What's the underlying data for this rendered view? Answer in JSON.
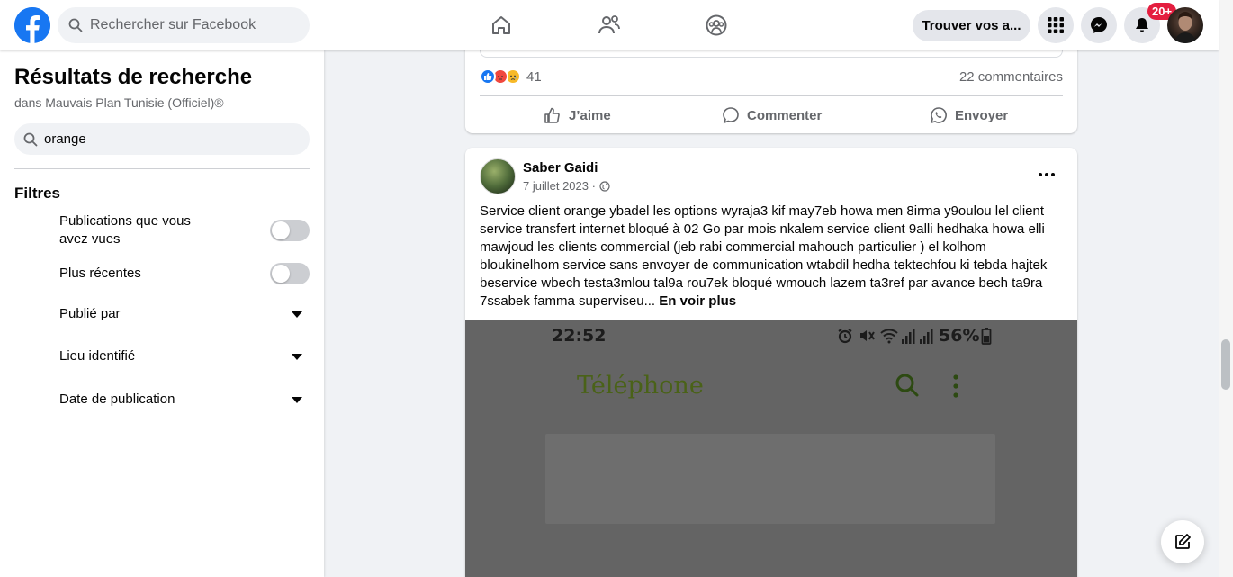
{
  "topbar": {
    "search_placeholder": "Rechercher sur Facebook",
    "find_friends_label": "Trouver vos a...",
    "notification_count": "20+"
  },
  "sidebar": {
    "title": "Résultats de recherche",
    "subtitle": "dans Mauvais Plan Tunisie (Officiel)®",
    "search_value": "orange",
    "filters_title": "Filtres",
    "filters": [
      {
        "label": "Publications que vous avez vues",
        "type": "toggle",
        "on": false
      },
      {
        "label": "Plus récentes",
        "type": "toggle",
        "on": false
      },
      {
        "label": "Publié par",
        "type": "dropdown"
      },
      {
        "label": "Lieu identifié",
        "type": "dropdown"
      },
      {
        "label": "Date de publication",
        "type": "dropdown"
      }
    ]
  },
  "post1": {
    "reaction_count": "41",
    "comments": "22 commentaires",
    "actions": {
      "like": "J’aime",
      "comment": "Commenter",
      "share": "Envoyer"
    }
  },
  "post2": {
    "author": "Saber Gaidi",
    "date": "7 juillet 2023 ·",
    "text": "Service client orange ybadel les options wyraja3 kif may7eb howa men 8irma y9oulou lel client service transfert internet bloqué à 02 Go par mois nkalem service client 9alli hedhaka howa elli mawjoud les clients commercial (jeb rabi commercial mahouch particulier ) el kolhom bloukinelhom service sans envoyer de communication wtabdil hedha tektechfou ki tebda hajtek beservice wbech testa3mlou tal9a rou7ek bloqué wmouch lazem ta3ref par avance bech ta9ra 7ssabek famma superviseu...",
    "see_more": "En voir plus",
    "image": {
      "time": "22:52",
      "battery": "56%",
      "app_title": "Téléphone"
    }
  },
  "colors": {
    "brand": "#1877f2",
    "badge": "#e41e3f",
    "secondary_text": "#65676b"
  }
}
